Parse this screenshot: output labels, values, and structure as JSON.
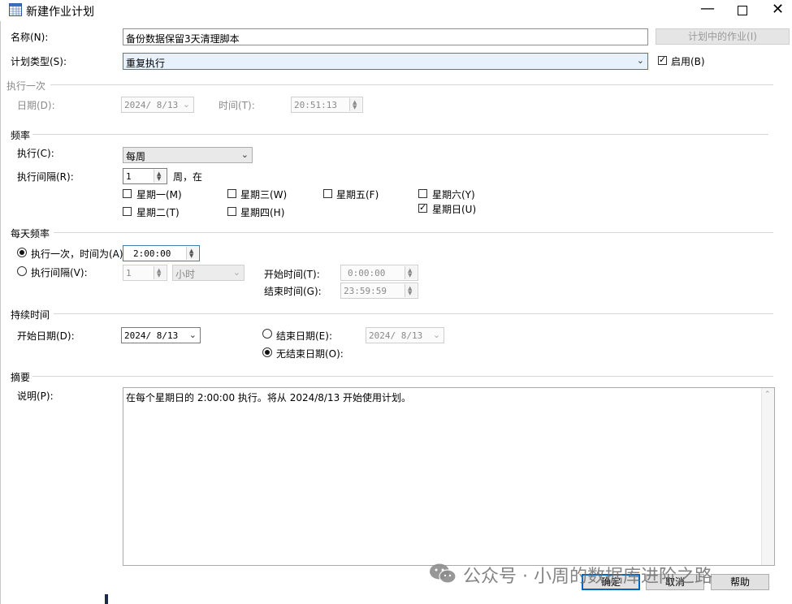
{
  "window": {
    "title": "新建作业计划",
    "icon": "calendar-grid-icon"
  },
  "controls": {
    "minimize": "minimize-icon",
    "maximize": "maximize-icon",
    "close": "close-icon"
  },
  "name": {
    "label": "名称(N):",
    "value": "备份数据保留3天清理脚本"
  },
  "jobs_button": {
    "label": "计划中的作业(I)"
  },
  "schedule_type": {
    "label": "计划类型(S):",
    "value": "重复执行",
    "enabled_label": "启用(B)",
    "enabled": true
  },
  "once": {
    "title": "执行一次",
    "date_label": "日期(D):",
    "date_value": "2024/ 8/13",
    "time_label": "时间(T):",
    "time_value": "20:51:13"
  },
  "frequency": {
    "title": "频率",
    "occurs_label": "执行(C):",
    "occurs_value": "每周",
    "recurs_label": "执行间隔(R):",
    "recurs_value": "1",
    "recurs_unit": "周，在",
    "days": [
      {
        "label": "星期一(M)",
        "checked": false
      },
      {
        "label": "星期三(W)",
        "checked": false
      },
      {
        "label": "星期五(F)",
        "checked": false
      },
      {
        "label": "星期六(Y)",
        "checked": false
      },
      {
        "label": "星期二(T)",
        "checked": false
      },
      {
        "label": "星期四(H)",
        "checked": false
      },
      {
        "label": "星期日(U)",
        "checked": true
      }
    ]
  },
  "daily": {
    "title": "每天频率",
    "once_label": "执行一次，时间为(A):",
    "once_value": "2:00:00",
    "every_label": "执行间隔(V):",
    "every_value": "1",
    "every_unit": "小时",
    "start_label": "开始时间(T):",
    "start_value": "0:00:00",
    "end_label": "结束时间(G):",
    "end_value": "23:59:59"
  },
  "duration": {
    "title": "持续时间",
    "start_label": "开始日期(D):",
    "start_value": "2024/ 8/13",
    "end_label": "结束日期(E):",
    "end_value": "2024/ 8/13",
    "noend_label": "无结束日期(O):"
  },
  "summary": {
    "title": "摘要",
    "desc_label": "说明(P):",
    "desc_value": "在每个星期日的 2:00:00 执行。将从 2024/8/13 开始使用计划。"
  },
  "buttons": {
    "ok": "确定",
    "cancel": "取消",
    "help": "帮助"
  },
  "watermark": {
    "text": "公众号 · 小周的数据库进阶之路"
  }
}
